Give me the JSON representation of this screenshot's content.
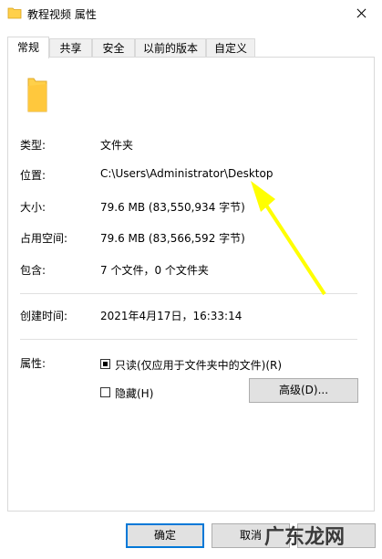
{
  "window": {
    "title": "教程视频 属性",
    "close_label": "✕"
  },
  "tabs": [
    {
      "label": "常规"
    },
    {
      "label": "共享"
    },
    {
      "label": "安全"
    },
    {
      "label": "以前的版本"
    },
    {
      "label": "自定义"
    }
  ],
  "general": {
    "type_label": "类型:",
    "type_value": "文件夹",
    "location_label": "位置:",
    "location_value": "C:\\Users\\Administrator\\Desktop",
    "size_label": "大小:",
    "size_value": "79.6 MB (83,550,934 字节)",
    "size_on_disk_label": "占用空间:",
    "size_on_disk_value": "79.6 MB (83,566,592 字节)",
    "contains_label": "包含:",
    "contains_value": "7 个文件，0 个文件夹",
    "created_label": "创建时间:",
    "created_value": "2021年4月17日，16:33:14",
    "attributes_label": "属性:",
    "readonly_label": "只读(仅应用于文件夹中的文件)(R)",
    "hidden_label": "隐藏(H)",
    "advanced_button": "高级(D)..."
  },
  "footer": {
    "ok_button": "确定",
    "cancel_button": "取消"
  },
  "watermark_text": "广东龙网",
  "colors": {
    "arrow": "#ffff00",
    "folder": "#ffd04a",
    "accent": "#0078d7"
  }
}
